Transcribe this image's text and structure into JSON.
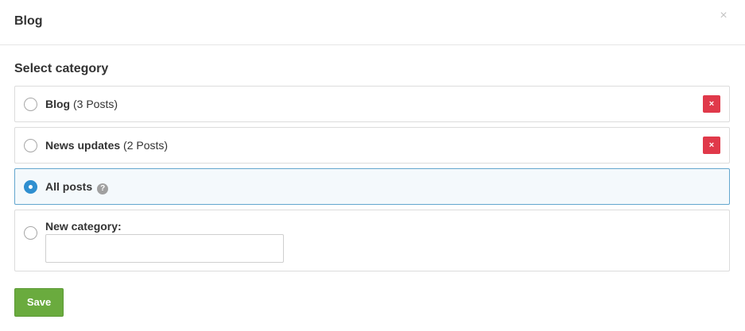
{
  "header": {
    "title": "Blog",
    "close_symbol": "×"
  },
  "section": {
    "title": "Select category"
  },
  "options": [
    {
      "name": "Blog",
      "count": "(3 Posts)",
      "delete_symbol": "×"
    },
    {
      "name": "News updates",
      "count": "(2 Posts)",
      "delete_symbol": "×"
    },
    {
      "name": "All posts",
      "help_symbol": "?"
    },
    {
      "name": "New category:",
      "input_value": ""
    }
  ],
  "selected_option": "All posts",
  "actions": {
    "save_label": "Save"
  },
  "colors": {
    "accent_blue": "#2f8fd0",
    "delete_red": "#e0394a",
    "save_green": "#6aab3e",
    "selected_bg": "#f4f9fc"
  }
}
